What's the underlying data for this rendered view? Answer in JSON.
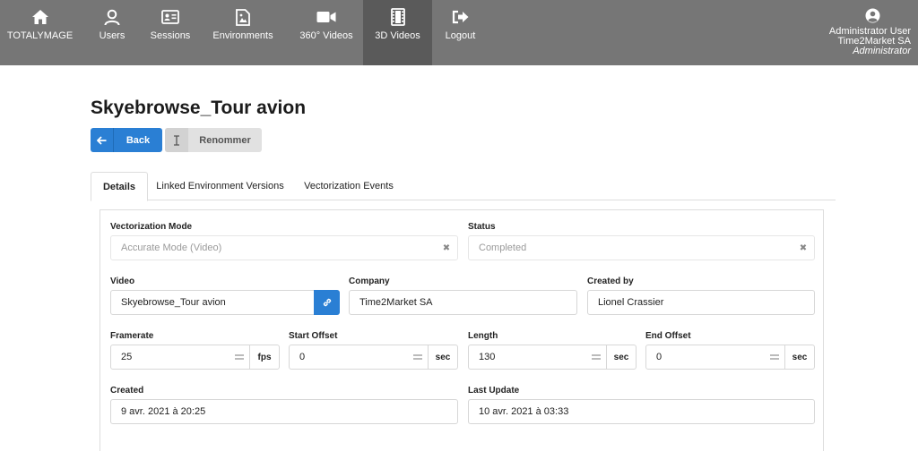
{
  "nav": {
    "items": [
      {
        "label": "TOTALYMAGE",
        "icon": "home-icon"
      },
      {
        "label": "Users",
        "icon": "user-icon"
      },
      {
        "label": "Sessions",
        "icon": "id-card-icon"
      },
      {
        "label": "Environments",
        "icon": "document-image-icon"
      },
      {
        "label": "360° Videos",
        "icon": "video-camera-icon"
      },
      {
        "label": "3D Videos",
        "icon": "film-strip-icon"
      },
      {
        "label": "Logout",
        "icon": "logout-icon"
      }
    ],
    "user": {
      "name": "Administrator User",
      "company": "Time2Market SA",
      "role": "Administrator"
    }
  },
  "page": {
    "title": "Skyebrowse_Tour avion",
    "back_label": "Back",
    "rename_label": "Renommer"
  },
  "tabs": [
    "Details",
    "Linked Environment Versions",
    "Vectorization Events"
  ],
  "form": {
    "vectorization_mode": {
      "label": "Vectorization Mode",
      "value": "Accurate Mode (Video)"
    },
    "status": {
      "label": "Status",
      "value": "Completed"
    },
    "video": {
      "label": "Video",
      "value": "Skyebrowse_Tour avion"
    },
    "company": {
      "label": "Company",
      "value": "Time2Market SA"
    },
    "created_by": {
      "label": "Created by",
      "value": "Lionel Crassier"
    },
    "framerate": {
      "label": "Framerate",
      "value": "25",
      "unit": "fps"
    },
    "start_offset": {
      "label": "Start Offset",
      "value": "0",
      "unit": "sec"
    },
    "length": {
      "label": "Length",
      "value": "130",
      "unit": "sec"
    },
    "end_offset": {
      "label": "End Offset",
      "value": "0",
      "unit": "sec"
    },
    "created": {
      "label": "Created",
      "value": "9 avr. 2021 à 20:25"
    },
    "last_update": {
      "label": "Last Update",
      "value": "10 avr. 2021 à 03:33"
    }
  },
  "colors": {
    "navbar": "#767676",
    "navbar_active": "#5a5a5a",
    "primary": "#2a7fd4"
  }
}
